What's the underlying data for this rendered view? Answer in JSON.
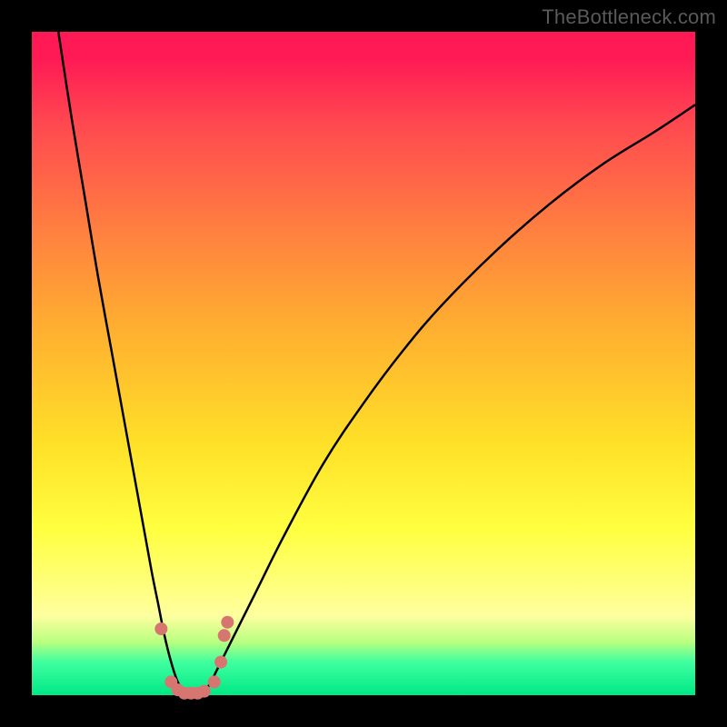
{
  "attribution": "TheBottleneck.com",
  "chart_data": {
    "type": "line",
    "title": "",
    "xlabel": "",
    "ylabel": "",
    "xlim": [
      0,
      100
    ],
    "ylim": [
      0,
      100
    ],
    "gradient_stops": [
      {
        "pct": 0,
        "color": "#ff1a55"
      },
      {
        "pct": 4,
        "color": "#ff1a55"
      },
      {
        "pct": 14,
        "color": "#ff4950"
      },
      {
        "pct": 30,
        "color": "#ff8040"
      },
      {
        "pct": 45,
        "color": "#ffb030"
      },
      {
        "pct": 62,
        "color": "#ffe028"
      },
      {
        "pct": 75,
        "color": "#ffff40"
      },
      {
        "pct": 84,
        "color": "#ffff80"
      },
      {
        "pct": 88,
        "color": "#ffffa0"
      },
      {
        "pct": 92,
        "color": "#b8ff80"
      },
      {
        "pct": 95,
        "color": "#40ffa0"
      },
      {
        "pct": 100,
        "color": "#00e885"
      }
    ],
    "series": [
      {
        "name": "bottleneck-curve",
        "stroke": "#000000",
        "stroke_width": 2.5,
        "x": [
          4,
          6,
          8,
          10,
          12,
          14,
          16,
          18,
          19,
          20,
          21,
          22,
          23,
          24,
          25,
          26,
          27,
          28,
          30,
          34,
          38,
          44,
          50,
          56,
          62,
          70,
          78,
          86,
          94,
          100
        ],
        "y": [
          100,
          87,
          75,
          63,
          52,
          41,
          30,
          19,
          14,
          9,
          5,
          2,
          0.5,
          0,
          0,
          0.5,
          2,
          4,
          8,
          16,
          24,
          35,
          44,
          52,
          59,
          67,
          74,
          80,
          85,
          89
        ]
      }
    ],
    "marker_cluster": {
      "color": "#d77570",
      "radius": 7,
      "points": [
        {
          "x": 19.5,
          "y": 10
        },
        {
          "x": 21,
          "y": 2
        },
        {
          "x": 22,
          "y": 0.8
        },
        {
          "x": 23,
          "y": 0.3
        },
        {
          "x": 24,
          "y": 0.3
        },
        {
          "x": 25,
          "y": 0.3
        },
        {
          "x": 26,
          "y": 0.6
        },
        {
          "x": 27.5,
          "y": 2
        },
        {
          "x": 28.5,
          "y": 5
        },
        {
          "x": 29,
          "y": 9
        },
        {
          "x": 29.5,
          "y": 11
        }
      ]
    }
  }
}
